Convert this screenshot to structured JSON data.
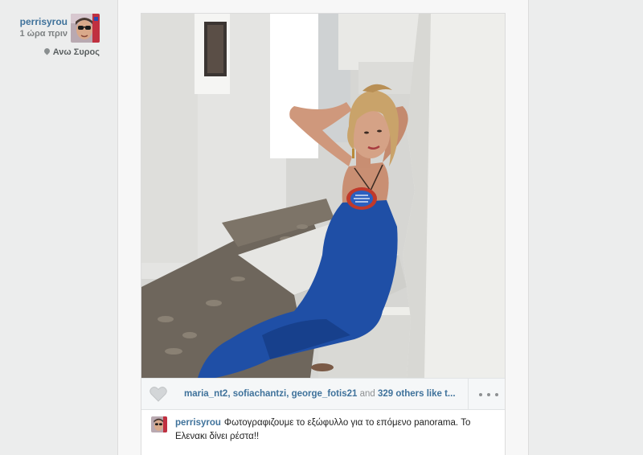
{
  "post": {
    "username": "perrisyrou",
    "time_ago": "1 ώρα πριν",
    "location": "Ανω Συρος"
  },
  "likes": {
    "users": [
      "maria_nt2",
      "sofiachantzi",
      "george_fotis21"
    ],
    "and_word": "and",
    "others": "329 others like t...",
    "more_label": "•••"
  },
  "caption": {
    "username": "perrisyrou",
    "text": "Φωτογραφιζουμε το εξώφυλλο για το επόμενο panorama. Το Ελενακι δίνει ρέστα!!"
  },
  "icons": {
    "like": "heart-icon",
    "location": "map-pin-icon",
    "more": "ellipsis-icon"
  },
  "colors": {
    "link": "#3f729b",
    "dress": "#1f4fa6",
    "wall": "#f2f2f2"
  }
}
